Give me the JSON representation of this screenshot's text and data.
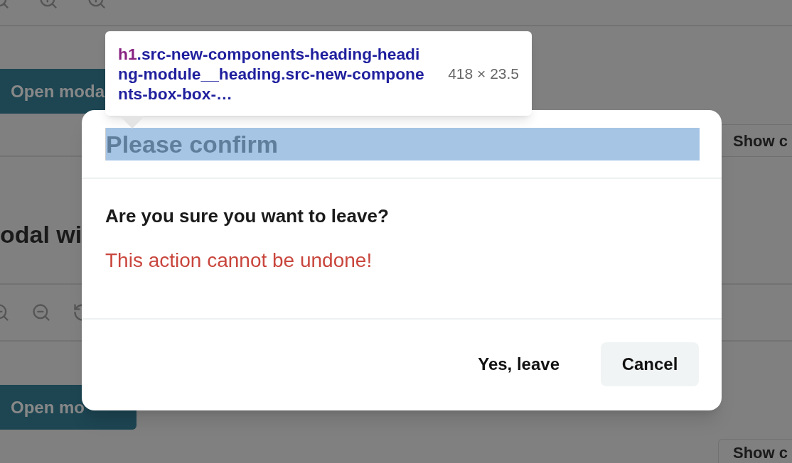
{
  "background": {
    "open_button_top": "Open moda",
    "show_button_top": "Show c",
    "heading": "odal wi",
    "open_button_bottom": "Open mo",
    "show_button_bottom": "Show c"
  },
  "modal": {
    "title": "Please confirm",
    "question": "Are you sure you want to leave?",
    "warning": "This action cannot be undone!",
    "buttons": [
      {
        "label": "Yes, leave",
        "kind": "text"
      },
      {
        "label": "Cancel",
        "kind": "secondary"
      }
    ]
  },
  "inspector_tooltip": {
    "tag": "h1",
    "selector": ".src-new-components-heading-heading-module__heading.src-new-components-box-box-…",
    "size": "418 × 23.5"
  }
}
